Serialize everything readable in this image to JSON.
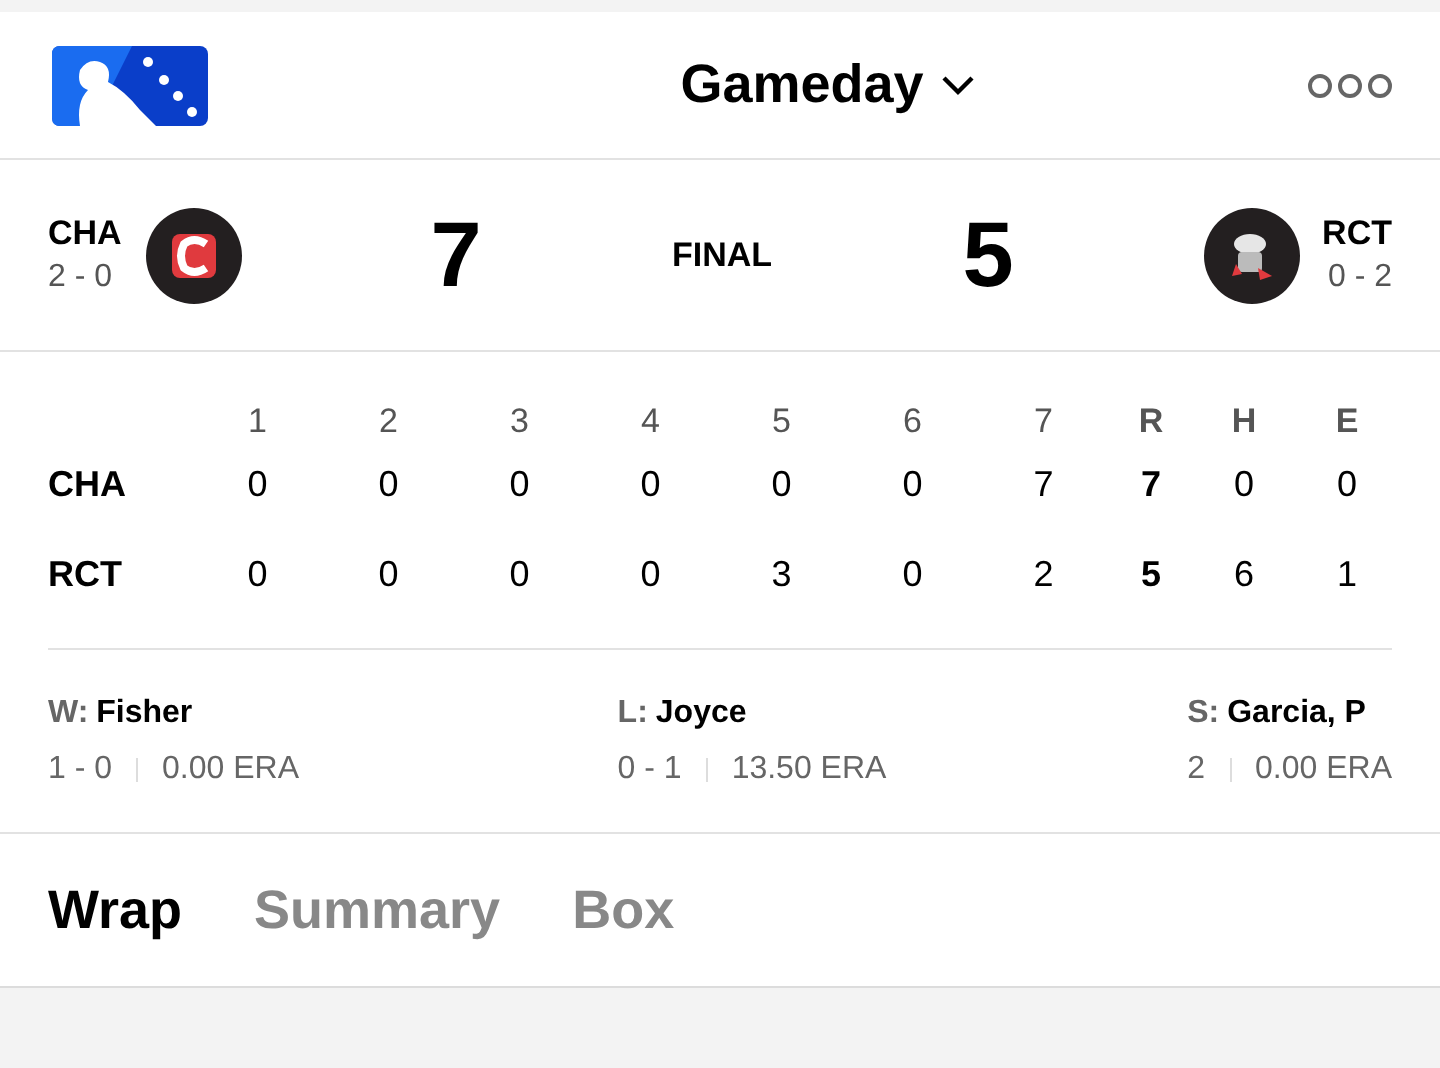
{
  "header": {
    "title": "Gameday"
  },
  "game": {
    "away": {
      "abbr": "CHA",
      "record": "2 - 0",
      "score": "7"
    },
    "status": "FINAL",
    "home": {
      "abbr": "RCT",
      "record": "0 - 2",
      "score": "5"
    }
  },
  "linescore": {
    "innings": [
      "1",
      "2",
      "3",
      "4",
      "5",
      "6",
      "7"
    ],
    "totals": [
      "R",
      "H",
      "E"
    ],
    "rows": [
      {
        "team": "CHA",
        "innings": [
          "0",
          "0",
          "0",
          "0",
          "0",
          "0",
          "7"
        ],
        "totals": [
          "7",
          "0",
          "0"
        ]
      },
      {
        "team": "RCT",
        "innings": [
          "0",
          "0",
          "0",
          "0",
          "3",
          "0",
          "2"
        ],
        "totals": [
          "5",
          "6",
          "1"
        ]
      }
    ]
  },
  "pitchers": [
    {
      "label": "W:",
      "name": "Fisher",
      "record": "1 - 0",
      "era": "0.00 ERA"
    },
    {
      "label": "L:",
      "name": "Joyce",
      "record": "0 - 1",
      "era": "13.50 ERA"
    },
    {
      "label": "S:",
      "name": "Garcia, P",
      "record": "2",
      "era": "0.00 ERA"
    }
  ],
  "tabs": [
    {
      "label": "Wrap",
      "selected": true
    },
    {
      "label": "Summary",
      "selected": false
    },
    {
      "label": "Box",
      "selected": false
    }
  ]
}
